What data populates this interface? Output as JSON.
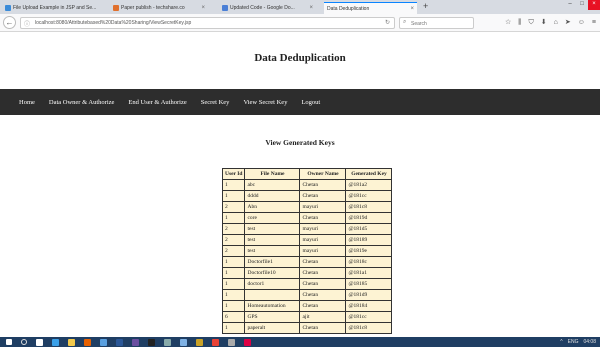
{
  "browser": {
    "tabs": [
      {
        "label": "File Upload Example in JSP and Se...",
        "icon_color": "#3b8bd8"
      },
      {
        "label": "Paper publish - techshare.co",
        "icon_color": "#e0702d"
      },
      {
        "label": "Updated Code - Google Do...",
        "icon_color": "#4a7fd6"
      },
      {
        "label": "Data Deduplication",
        "icon_color": "#bbbbbb"
      }
    ],
    "active_tab": 3,
    "close_glyph": "×",
    "new_tab_glyph": "+",
    "url": "localhost:8080/Attributebased%20Data%20Sharing/ViewSecretKey.jsp",
    "search_placeholder": "Search",
    "icons": [
      "star-icon",
      "library-icon",
      "shield-icon",
      "download-icon",
      "home-icon",
      "send-icon",
      "smiley-icon",
      "menu-icon"
    ]
  },
  "page": {
    "title": "Data Deduplication",
    "menu": [
      "Home",
      "Data Owner & Authorize",
      "End User & Authorize",
      "Secret Key",
      "View Secret Key",
      "Logout"
    ],
    "section_title": "View Generated Keys",
    "table": {
      "headers": [
        "User Id",
        "File Name",
        "Owner Name",
        "Generated Key"
      ],
      "rows": [
        [
          "1",
          "abc",
          "Chetan",
          "@181a2"
        ],
        [
          "1",
          "dddd",
          "Chetan",
          "@181cc"
        ],
        [
          "2",
          "Abn",
          "mayuri",
          "@181c8"
        ],
        [
          "1",
          "core",
          "Chetan",
          "@1819d"
        ],
        [
          "2",
          "test",
          "mayuri",
          "@181d5"
        ],
        [
          "2",
          "test",
          "mayuri",
          "@18189"
        ],
        [
          "2",
          "test",
          "mayuri",
          "@1819e"
        ],
        [
          "1",
          "Doctorfile1",
          "Chetan",
          "@1818c"
        ],
        [
          "1",
          "Doctorfile10",
          "Chetan",
          "@181a1"
        ],
        [
          "1",
          "doctor1",
          "Chetan",
          "@18185"
        ],
        [
          "1",
          "",
          "Chetan",
          "@181d9"
        ],
        [
          "1",
          "Homeautomation",
          "Chetan",
          "@18184"
        ],
        [
          "6",
          "GPS",
          "ajit",
          "@181cc"
        ],
        [
          "1",
          "paperalt",
          "Chetan",
          "@181c8"
        ]
      ]
    }
  },
  "colors": {
    "menu_bg": "#2d2d2d",
    "table_bg": "#fdf3d3",
    "taskbar_bg": "#1f3e63",
    "accent": "#0a84ff"
  },
  "taskbar": {
    "apps": [
      {
        "name": "start-icon",
        "color": "#ffffff"
      },
      {
        "name": "search-icon",
        "color": ""
      },
      {
        "name": "cortana-icon",
        "color": "#ffffff"
      },
      {
        "name": "edge-icon",
        "color": "#3aa0e8"
      },
      {
        "name": "explorer-icon",
        "color": "#f2c94c"
      },
      {
        "name": "firefox-icon",
        "color": "#e66000"
      },
      {
        "name": "store-icon",
        "color": "#5aa0e0"
      },
      {
        "name": "word-icon",
        "color": "#2b5797"
      },
      {
        "name": "eclipse-icon",
        "color": "#6a4fa0"
      },
      {
        "name": "terminal-icon",
        "color": "#222222"
      },
      {
        "name": "settings-icon",
        "color": "#8aa"
      },
      {
        "name": "photos-icon",
        "color": "#7fb2e5"
      },
      {
        "name": "app-icon",
        "color": "#c9a227"
      },
      {
        "name": "chrome-icon",
        "color": "#e94235"
      },
      {
        "name": "paint-icon",
        "color": "#aaa"
      },
      {
        "name": "tool-icon",
        "color": "#d04"
      }
    ],
    "tray": [
      "^",
      "ENG",
      "04:08"
    ]
  }
}
